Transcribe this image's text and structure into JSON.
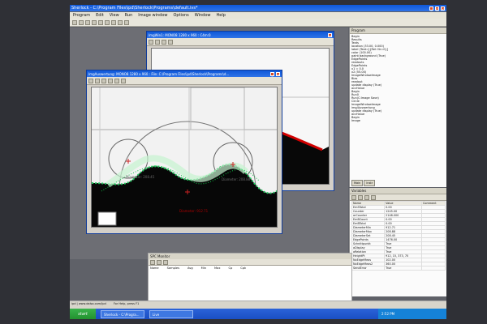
{
  "app": {
    "main_title": "Sherlock - C:\\Program Files\\ipd\\Sherlock\\Programs\\default.ivs*",
    "menu": [
      "Program",
      "Edit",
      "View",
      "Run",
      "Image window",
      "Options",
      "Window",
      "Help"
    ],
    "windows": {
      "back_title": "ImgWin1: MONO8 1280 x 960 : C4m:0",
      "front_title": "ImgAuswertung: MONO8 1280 x 960 : File: C:\\Program Files\\ipd\\Sherlock\\Programs\\d..."
    },
    "canvas_labels": {
      "left": "Diameter: 208.45",
      "right": "Diameter: 208.88",
      "bottom": "Diameter: 912.71"
    },
    "right_panel": {
      "title": "Program",
      "tree": [
        "Begin",
        "Results",
        "Texts",
        "location (33.00, 0.000)",
        "label (Text=[{Rel: Nr=0}]",
        "color (100.00)",
        "paint background (True)",
        "EdgePoints",
        "readouts",
        "EdgePoints",
        "x1 = 0.0",
        "x2 (55.00)",
        "ImageWindowImage",
        "Bias",
        "readout",
        "update display (True)",
        "accHalue",
        "Begin",
        "Run0",
        "Run(C:Image Save)",
        "Circle",
        "ImageWindowImage",
        "img/Auswertung",
        "update display (True)",
        "accHalue",
        "Begin",
        "Image"
      ],
      "tabs": [
        "Main",
        "Instr"
      ]
    },
    "variables": {
      "title": "Variables",
      "columns": [
        "Name",
        "Value",
        "Comment"
      ],
      "rows": [
        [
          "EmSTotal",
          "0.00",
          ""
        ],
        [
          "Counter",
          "1245.00",
          ""
        ],
        [
          "arCounter",
          "2148.000",
          ""
        ],
        [
          "EmBCount",
          "0.00",
          ""
        ],
        [
          "EmBTotal",
          "0.00",
          ""
        ],
        [
          "DiameterMin",
          "912.71",
          ""
        ],
        [
          "DiameterMax",
          "208.88",
          ""
        ],
        [
          "DiameterSet",
          "208.45",
          ""
        ],
        [
          "EdgePoints",
          "1476.00",
          ""
        ],
        [
          "Schnittpunkt",
          "True",
          ""
        ],
        [
          "aDisplay",
          "True",
          ""
        ],
        [
          "aRelation",
          "True",
          ""
        ],
        [
          "HeightPt",
          "912, 15, 373, 70",
          ""
        ],
        [
          "NoEdgeMeas",
          "102.00",
          ""
        ],
        [
          "NoEdgeMeas2",
          "360.00",
          ""
        ],
        [
          "SendError",
          "True",
          ""
        ]
      ]
    },
    "spc": {
      "title": "SPC Monitor",
      "columns": [
        "Name",
        "Samples",
        "Avg",
        "Min",
        "Max",
        "Cp",
        "Cpk"
      ]
    },
    "taskbar": {
      "start": "start",
      "task1": "Sherlock - C:\\Progra...",
      "task2": "Live",
      "tray": "2:52 PM"
    },
    "status": {
      "left": "ipd | www.dalsa.com/ipd",
      "right": "For Help, press F1"
    }
  }
}
